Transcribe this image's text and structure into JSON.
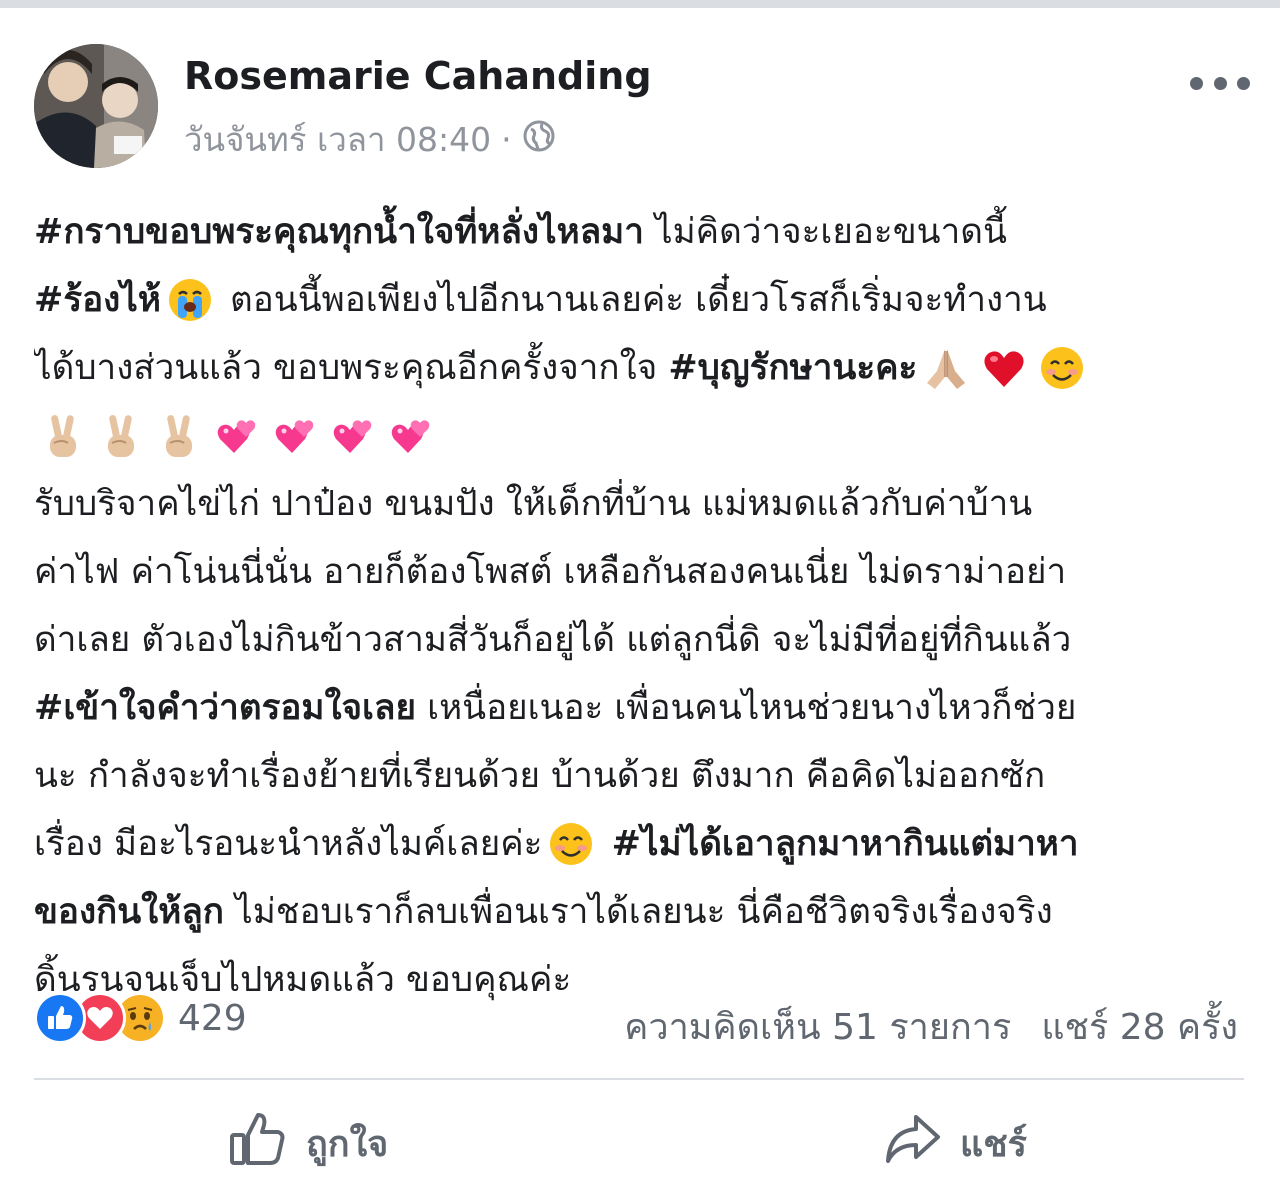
{
  "post": {
    "author": "Rosemarie Cahanding",
    "timestamp": "วันจันทร์ เวลา 08:40",
    "separator": "·",
    "privacy_icon": "globe-icon",
    "more_icon": "more-dots-icon",
    "lines": [
      [
        {
          "t": "#กราบขอบพระคุณทุกน้ำใจที่หลั่งไหลมา",
          "b": true
        },
        {
          "t": " ไม่คิดว่าจะเยอะขนาดนี้"
        }
      ],
      [
        {
          "t": "#ร้องไห้",
          "b": true
        },
        {
          "e": "crying-face-emoji"
        },
        {
          "t": " ตอนนี้พอเพียงไปอีกนานเลยค่ะ เดี๋ยวโรสก็เริ่มจะทำงาน"
        }
      ],
      [
        {
          "t": "ได้บางส่วนแล้ว ขอบพระคุณอีกครั้งจากใจ "
        },
        {
          "t": "#บุญรักษานะคะ",
          "b": true
        },
        {
          "e": "folded-hands-emoji"
        },
        {
          "e": "red-heart-emoji"
        },
        {
          "e": "smiling-face-emoji"
        }
      ],
      [
        {
          "e": "victory-hand-emoji"
        },
        {
          "e": "victory-hand-emoji"
        },
        {
          "e": "victory-hand-emoji"
        },
        {
          "e": "two-hearts-emoji"
        },
        {
          "e": "two-hearts-emoji"
        },
        {
          "e": "two-hearts-emoji"
        },
        {
          "e": "two-hearts-emoji"
        }
      ],
      [
        {
          "t": "รับบริจาคไข่ไก่ ปาป๋อง ขนมปัง ให้เด็กที่บ้าน แม่หมดแล้วกับค่าบ้าน"
        }
      ],
      [
        {
          "t": "ค่าไฟ ค่าโน่นนี่นั่น อายก็ต้องโพสต์ เหลือกันสองคนเนี่ย ไม่ดราม่าอย่า"
        }
      ],
      [
        {
          "t": "ด่าเลย ตัวเองไม่กินข้าวสามสี่วันก็อยู่ได้ แต่ลูกนี่ดิ จะไม่มีที่อยู่ที่กินแล้ว"
        }
      ],
      [
        {
          "t": "#เข้าใจคำว่าตรอมใจเลย",
          "b": true
        },
        {
          "t": " เหนื่อยเนอะ เพื่อนคนไหนช่วยนางไหวก็ช่วย"
        }
      ],
      [
        {
          "t": "นะ กำลังจะทำเรื่องย้ายที่เรียนด้วย บ้านด้วย ตึงมาก คือคิดไม่ออกซัก"
        }
      ],
      [
        {
          "t": "เรื่อง มีอะไรอนะนำหลังไมค์เลยค่ะ"
        },
        {
          "e": "smiling-face-emoji"
        },
        {
          "t": " "
        },
        {
          "t": "#ไม่ได้เอาลูกมาหากินแต่มาหา",
          "b": true
        }
      ],
      [
        {
          "t": "ของกินให้ลูก",
          "b": true
        },
        {
          "t": " ไม่ชอบเราก็ลบเพื่อนเราได้เลยนะ นี่คือชีวิตจริงเรื่องจริง"
        }
      ],
      [
        {
          "t": "ดิ้นรนจนเจ็บไปหมดแล้ว ขอบคุณค่ะ"
        }
      ]
    ]
  },
  "reactions": {
    "icons": [
      "like-icon",
      "love-icon",
      "sad-icon"
    ],
    "count": "429"
  },
  "stats": {
    "comments": "ความคิดเห็น 51 รายการ",
    "shares": "แชร์ 28 ครั้ง"
  },
  "actions": {
    "like_label": "ถูกใจ",
    "share_label": "แชร์"
  },
  "colors": {
    "like_blue": "#1877f2",
    "love_red": "#f33e58",
    "sad_yellow": "#f7b125",
    "secondary_text": "#606770"
  }
}
